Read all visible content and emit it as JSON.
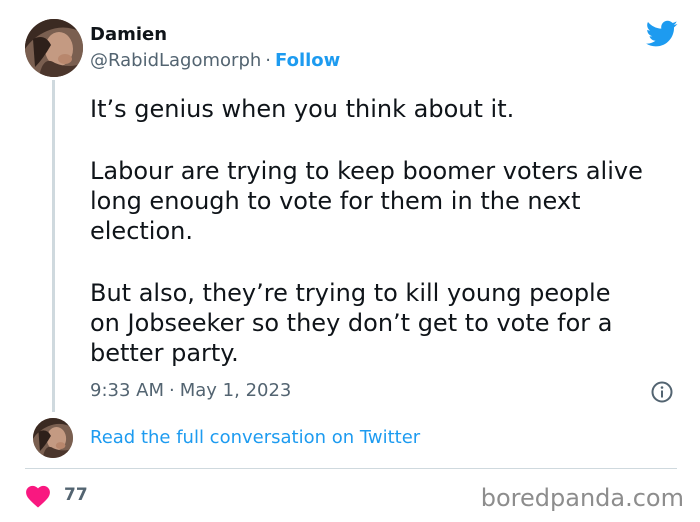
{
  "author": {
    "display_name": "Damien",
    "handle": "@RabidLagomorph",
    "separator": "·",
    "follow_label": "Follow"
  },
  "tweet": {
    "paragraphs": [
      [
        "It’s genius when you think about it."
      ],
      [
        "Labour are trying to keep boomer voters alive",
        "long enough to vote for them in the next",
        "election."
      ],
      [
        "But also, they’re trying to kill young people",
        "on Jobseeker so they don’t get to vote for a",
        "better party."
      ]
    ],
    "time": "9:33 AM",
    "date": "May 1, 2023",
    "separator": "·"
  },
  "conversation_link": "Read the full conversation on Twitter",
  "likes": {
    "count": "77"
  },
  "watermark": "boredpanda.com",
  "colors": {
    "accent": "#1d9bf0",
    "like": "#f91880",
    "secondary_text": "#536471",
    "divider": "#cfd9de"
  },
  "icons": [
    "twitter-bird-icon",
    "info-icon",
    "heart-icon"
  ]
}
